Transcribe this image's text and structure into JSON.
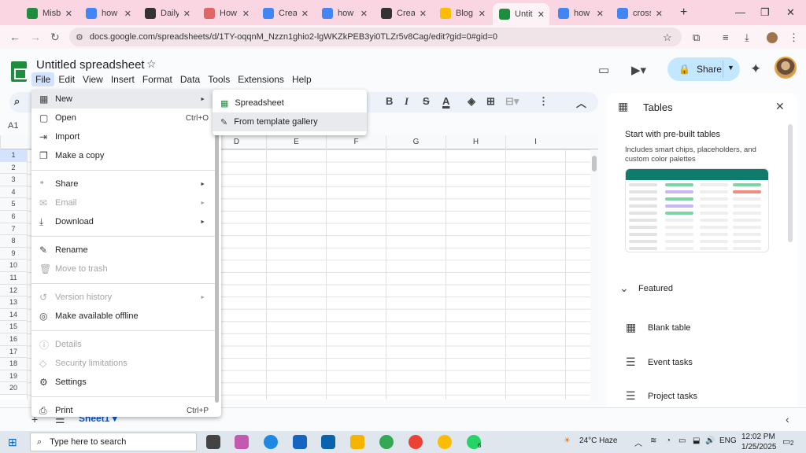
{
  "browser": {
    "tabs": [
      {
        "title": "Misb",
        "color": "#1e8e3e"
      },
      {
        "title": "how t",
        "color": "#4285f4"
      },
      {
        "title": "Daily",
        "color": "#333333"
      },
      {
        "title": "How",
        "color": "#e06666"
      },
      {
        "title": "Creat",
        "color": "#4285f4"
      },
      {
        "title": "how t",
        "color": "#4285f4"
      },
      {
        "title": "Creat",
        "color": "#333333"
      },
      {
        "title": "Blog",
        "color": "#fbbc04"
      },
      {
        "title": "Untit",
        "color": "#1e8e3e"
      },
      {
        "title": "how t",
        "color": "#4285f4"
      },
      {
        "title": "cross",
        "color": "#4285f4"
      }
    ],
    "url": "docs.google.com/spreadsheets/d/1TY-oqqnM_Nzzn1ghio2-lgWKZkPEB3yi0TLZr5v8Cag/edit?gid=0#gid=0"
  },
  "sheets": {
    "title": "Untitled spreadsheet",
    "menus": [
      "File",
      "Edit",
      "View",
      "Insert",
      "Format",
      "Data",
      "Tools",
      "Extensions",
      "Help"
    ],
    "share_label": "Share",
    "namebox": "A1",
    "columns": [
      "D",
      "E",
      "F",
      "G",
      "H",
      "I"
    ],
    "rows": [
      "1",
      "2",
      "3",
      "4",
      "5",
      "6",
      "7",
      "8",
      "9",
      "10",
      "11",
      "12",
      "13",
      "14",
      "15",
      "16",
      "17",
      "18",
      "19",
      "20"
    ],
    "sheet_tab": "Sheet1"
  },
  "file_menu": {
    "items": [
      {
        "label": "New",
        "icon": "new-sheet-icon",
        "arrow": true,
        "highlighted": true
      },
      {
        "label": "Open",
        "icon": "folder-icon",
        "shortcut": "Ctrl+O"
      },
      {
        "label": "Import",
        "icon": "import-icon"
      },
      {
        "label": "Make a copy",
        "icon": "copy-icon"
      },
      {
        "label": "Share",
        "icon": "person-add-icon",
        "arrow": true
      },
      {
        "label": "Email",
        "icon": "mail-icon",
        "arrow": true,
        "disabled": true
      },
      {
        "label": "Download",
        "icon": "download-icon",
        "arrow": true
      },
      {
        "label": "Rename",
        "icon": "pencil-icon"
      },
      {
        "label": "Move to trash",
        "icon": "trash-icon",
        "disabled": true
      },
      {
        "label": "Version history",
        "icon": "history-icon",
        "arrow": true,
        "disabled": true
      },
      {
        "label": "Make available offline",
        "icon": "offline-icon"
      },
      {
        "label": "Details",
        "icon": "info-icon",
        "disabled": true
      },
      {
        "label": "Security limitations",
        "icon": "shield-icon",
        "disabled": true
      },
      {
        "label": "Settings",
        "icon": "gear-icon"
      },
      {
        "label": "Print",
        "icon": "print-icon",
        "shortcut": "Ctrl+P"
      }
    ]
  },
  "new_submenu": {
    "items": [
      {
        "label": "Spreadsheet",
        "icon": "sheets-icon"
      },
      {
        "label": "From template gallery",
        "icon": "template-icon",
        "highlighted": true
      }
    ]
  },
  "tables_panel": {
    "title": "Tables",
    "heading": "Start with pre-built tables",
    "subtext": "Includes smart chips, placeholders, and custom color palettes",
    "featured_label": "Featured",
    "items": [
      "Blank table",
      "Event tasks",
      "Project tasks"
    ]
  },
  "taskbar": {
    "search_placeholder": "Type here to search",
    "weather": "24°C  Haze",
    "language": "ENG",
    "time": "12:02 PM",
    "date": "1/25/2025",
    "notification_count": "2",
    "whatsapp_badge": "6"
  }
}
